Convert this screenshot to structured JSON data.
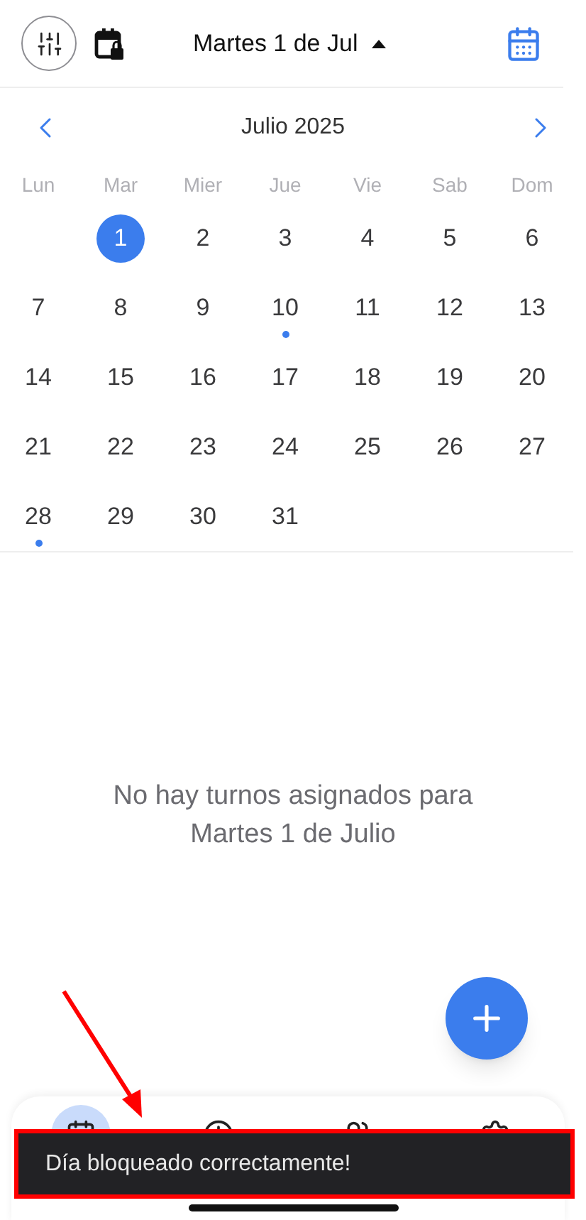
{
  "header": {
    "title": "Martes 1 de Jul"
  },
  "calendar": {
    "month": "Julio 2025",
    "weekdays": [
      "Lun",
      "Mar",
      "Mier",
      "Jue",
      "Vie",
      "Sab",
      "Dom"
    ],
    "weeks": [
      [
        {
          "kind": "blank"
        },
        {
          "kind": "day",
          "day": "1",
          "selected": true,
          "has_events": false
        },
        {
          "kind": "day",
          "day": "2",
          "selected": false,
          "has_events": false
        },
        {
          "kind": "day",
          "day": "3",
          "selected": false,
          "has_events": false
        },
        {
          "kind": "day",
          "day": "4",
          "selected": false,
          "has_events": false
        },
        {
          "kind": "day",
          "day": "5",
          "selected": false,
          "has_events": false
        },
        {
          "kind": "day",
          "day": "6",
          "selected": false,
          "has_events": false
        }
      ],
      [
        {
          "kind": "day",
          "day": "7",
          "selected": false,
          "has_events": false
        },
        {
          "kind": "day",
          "day": "8",
          "selected": false,
          "has_events": false
        },
        {
          "kind": "day",
          "day": "9",
          "selected": false,
          "has_events": false
        },
        {
          "kind": "day",
          "day": "10",
          "selected": false,
          "has_events": true
        },
        {
          "kind": "day",
          "day": "11",
          "selected": false,
          "has_events": false
        },
        {
          "kind": "day",
          "day": "12",
          "selected": false,
          "has_events": false
        },
        {
          "kind": "day",
          "day": "13",
          "selected": false,
          "has_events": false
        }
      ],
      [
        {
          "kind": "day",
          "day": "14",
          "selected": false,
          "has_events": false
        },
        {
          "kind": "day",
          "day": "15",
          "selected": false,
          "has_events": false
        },
        {
          "kind": "day",
          "day": "16",
          "selected": false,
          "has_events": false
        },
        {
          "kind": "day",
          "day": "17",
          "selected": false,
          "has_events": false
        },
        {
          "kind": "day",
          "day": "18",
          "selected": false,
          "has_events": false
        },
        {
          "kind": "day",
          "day": "19",
          "selected": false,
          "has_events": false
        },
        {
          "kind": "day",
          "day": "20",
          "selected": false,
          "has_events": false
        }
      ],
      [
        {
          "kind": "day",
          "day": "21",
          "selected": false,
          "has_events": false
        },
        {
          "kind": "day",
          "day": "22",
          "selected": false,
          "has_events": false
        },
        {
          "kind": "day",
          "day": "23",
          "selected": false,
          "has_events": false
        },
        {
          "kind": "day",
          "day": "24",
          "selected": false,
          "has_events": false
        },
        {
          "kind": "day",
          "day": "25",
          "selected": false,
          "has_events": false
        },
        {
          "kind": "day",
          "day": "26",
          "selected": false,
          "has_events": false
        },
        {
          "kind": "day",
          "day": "27",
          "selected": false,
          "has_events": false
        }
      ],
      [
        {
          "kind": "day",
          "day": "28",
          "selected": false,
          "has_events": true
        },
        {
          "kind": "day",
          "day": "29",
          "selected": false,
          "has_events": false
        },
        {
          "kind": "day",
          "day": "30",
          "selected": false,
          "has_events": false
        },
        {
          "kind": "day",
          "day": "31",
          "selected": false,
          "has_events": false
        },
        {
          "kind": "blank"
        },
        {
          "kind": "blank"
        },
        {
          "kind": "blank"
        }
      ]
    ]
  },
  "empty_message": "No hay turnos asignados para Martes 1 de Julio",
  "bottom_nav": [
    {
      "selected": true
    },
    {
      "selected": false
    },
    {
      "selected": false
    },
    {
      "selected": false
    }
  ],
  "toast": {
    "message": "Día bloqueado correctamente!"
  }
}
